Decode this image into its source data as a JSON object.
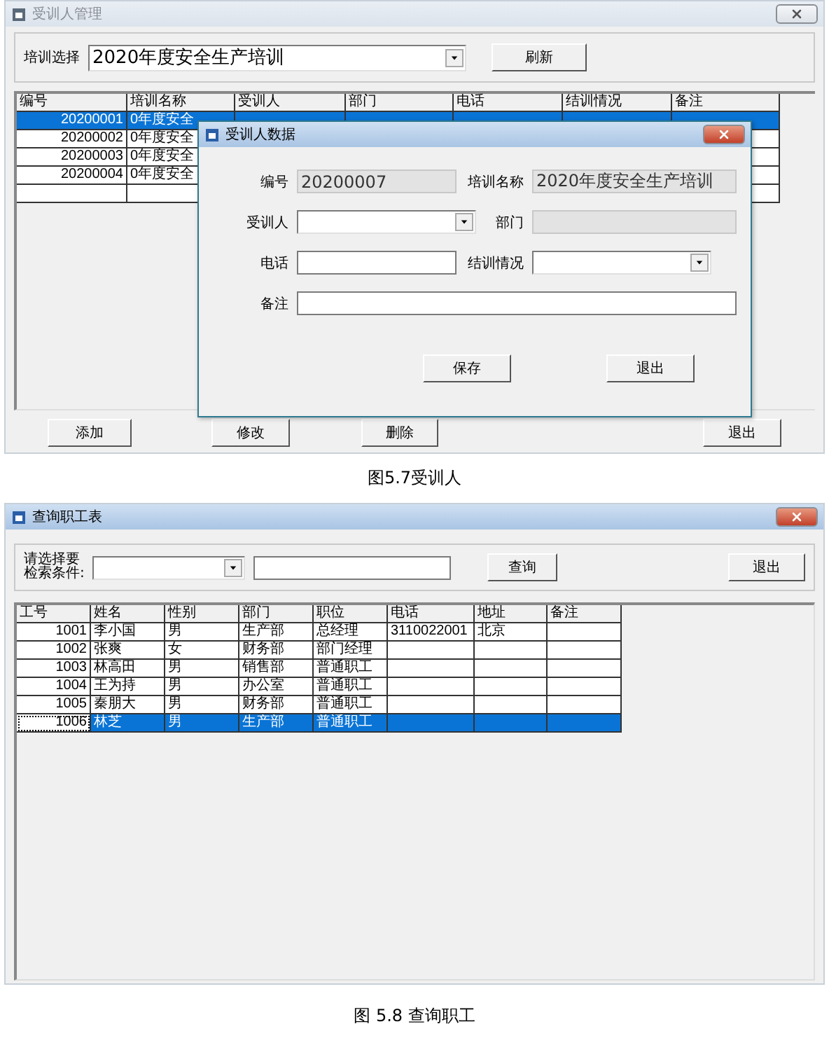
{
  "figures": [
    {
      "window": {
        "title": "受训人管理",
        "active": false
      },
      "filter": {
        "label": "培训选择",
        "value": "2020年度安全生产培训",
        "button": "刷新"
      },
      "table": {
        "columns": [
          "编号",
          "培训名称",
          "受训人",
          "部门",
          "电话",
          "结训情况",
          "备注"
        ],
        "rows": [
          {
            "cells": [
              "20200001",
              "0年度安全"
            ],
            "selected": true
          },
          {
            "cells": [
              "20200002",
              "0年度安全"
            ],
            "selected": false
          },
          {
            "cells": [
              "20200003",
              "0年度安全"
            ],
            "selected": false
          },
          {
            "cells": [
              "20200004",
              "0年度安全"
            ],
            "selected": false
          },
          {
            "cells": [],
            "selected": false
          }
        ]
      },
      "dialog": {
        "title": "受训人数据",
        "active": true,
        "fields": [
          {
            "label": "编号",
            "value": "20200007",
            "kind": "readonly"
          },
          {
            "label": "培训名称",
            "value": "2020年度安全生产培训",
            "kind": "readonly"
          },
          {
            "label": "受训人",
            "kind": "combo"
          },
          {
            "label": "部门",
            "kind": "readonly"
          },
          {
            "label": "电话",
            "kind": "text"
          },
          {
            "label": "结训情况",
            "kind": "combo"
          },
          {
            "label": "备注",
            "kind": "text"
          }
        ],
        "buttons": [
          "保存",
          "退出"
        ]
      },
      "buttons": [
        "添加",
        "修改",
        "删除",
        "退出"
      ],
      "caption": "图5.7受训人"
    },
    {
      "window": {
        "title": "查询职工表",
        "active": true
      },
      "search": {
        "label_lines": [
          "请选择要",
          "检索条件:"
        ],
        "button": "查询",
        "exit": "退出"
      },
      "table": {
        "columns": [
          "工号",
          "姓名",
          "性别",
          "部门",
          "职位",
          "电话",
          "地址",
          "备注"
        ],
        "rows": [
          {
            "cells": [
              "1001",
              "李小国",
              "男",
              "生产部",
              "总经理",
              "3110022001",
              "北京",
              ""
            ],
            "selected": false
          },
          {
            "cells": [
              "1002",
              "张爽",
              "女",
              "财务部",
              "部门经理",
              "",
              "",
              ""
            ],
            "selected": false
          },
          {
            "cells": [
              "1003",
              "林高田",
              "男",
              "销售部",
              "普通职工",
              "",
              "",
              ""
            ],
            "selected": false
          },
          {
            "cells": [
              "1004",
              "王为持",
              "男",
              "办公室",
              "普通职工",
              "",
              "",
              ""
            ],
            "selected": false
          },
          {
            "cells": [
              "1005",
              "秦朋大",
              "男",
              "财务部",
              "普通职工",
              "",
              "",
              ""
            ],
            "selected": false
          },
          {
            "cells": [
              "1006",
              "林芝",
              "男",
              "生产部",
              "普通职工",
              "",
              "",
              ""
            ],
            "selected": true,
            "focused": true
          }
        ]
      },
      "caption": "图 5.8 查询职工"
    }
  ]
}
